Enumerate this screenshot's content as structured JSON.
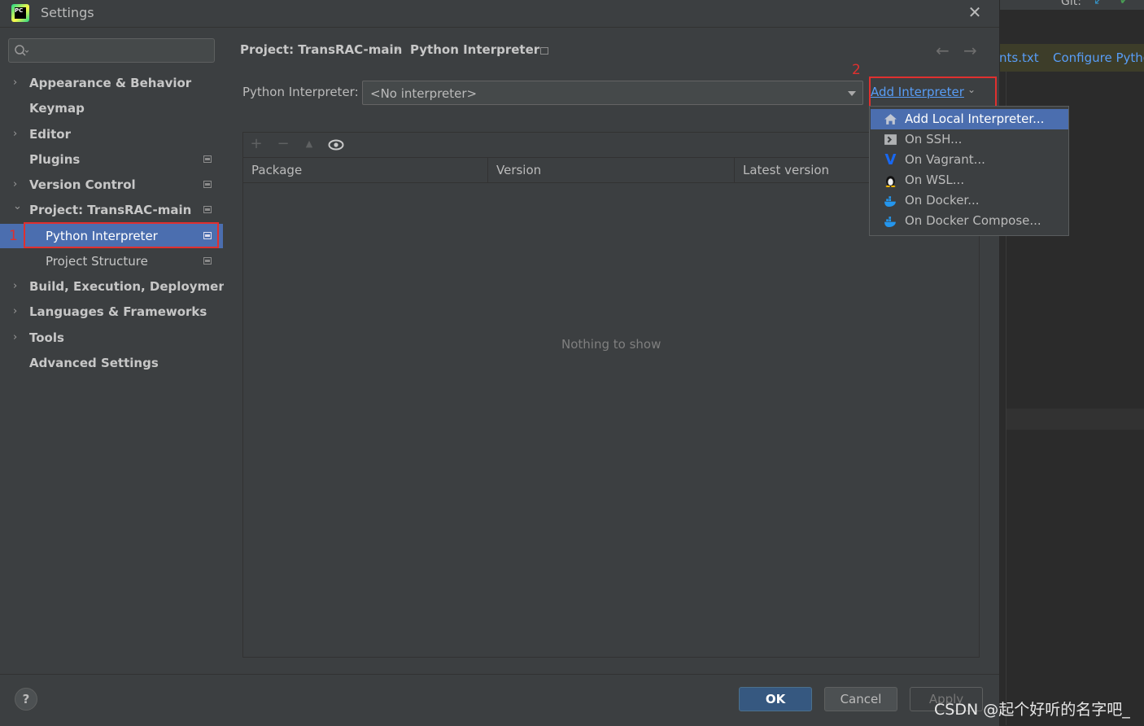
{
  "window": {
    "title": "Settings",
    "logo_text": "PC"
  },
  "sidebar": {
    "search_placeholder": "",
    "items": [
      {
        "label": "Appearance & Behavior",
        "expandable": true,
        "expanded": false,
        "project_icon": false
      },
      {
        "label": "Keymap",
        "expandable": false,
        "project_icon": false
      },
      {
        "label": "Editor",
        "expandable": true,
        "expanded": false,
        "project_icon": false
      },
      {
        "label": "Plugins",
        "expandable": false,
        "project_icon": true
      },
      {
        "label": "Version Control",
        "expandable": true,
        "expanded": false,
        "project_icon": true
      },
      {
        "label": "Project: TransRAC-main",
        "expandable": true,
        "expanded": true,
        "project_icon": true
      },
      {
        "label": "Python Interpreter",
        "child": true,
        "selected": true,
        "project_icon": true
      },
      {
        "label": "Project Structure",
        "child": true,
        "project_icon": true
      },
      {
        "label": "Build, Execution, Deployment",
        "expandable": true,
        "expanded": false,
        "project_icon": false
      },
      {
        "label": "Languages & Frameworks",
        "expandable": true,
        "expanded": false,
        "project_icon": false
      },
      {
        "label": "Tools",
        "expandable": true,
        "expanded": false,
        "project_icon": false
      },
      {
        "label": "Advanced Settings",
        "expandable": false,
        "project_icon": false
      }
    ]
  },
  "breadcrumb": {
    "project": "Project: TransRAC-main",
    "separator": "›",
    "page": "Python Interpreter"
  },
  "nav": {
    "back": "←",
    "forward": "→"
  },
  "interpreter": {
    "label": "Python Interpreter:",
    "value": "<No interpreter>",
    "add_link": "Add Interpreter"
  },
  "annotations": {
    "marker_1": "1",
    "marker_2": "2",
    "color": "#e0302f"
  },
  "packages": {
    "toolbar": {
      "add": "+",
      "remove": "−",
      "upgrade": "▲",
      "show_early": "👁"
    },
    "columns": [
      "Package",
      "Version",
      "Latest version"
    ],
    "empty_text": "Nothing to show"
  },
  "add_menu": {
    "items": [
      {
        "label": "Add Local Interpreter...",
        "icon": "house-icon",
        "highlighted": true
      },
      {
        "label": "On SSH...",
        "icon": "terminal-icon"
      },
      {
        "label": "On Vagrant...",
        "icon": "vagrant-icon"
      },
      {
        "label": "On WSL...",
        "icon": "linux-penguin-icon"
      },
      {
        "label": "On Docker...",
        "icon": "docker-icon"
      },
      {
        "label": "On Docker Compose...",
        "icon": "docker-compose-icon"
      }
    ]
  },
  "buttons": {
    "help": "?",
    "ok": "OK",
    "cancel": "Cancel",
    "apply": "Apply"
  },
  "background_ide": {
    "notification_file": "nts.txt",
    "notification_action": "Configure Pytho",
    "toolbar_text": "Git:"
  },
  "watermark": "CSDN @起个好听的名字吧_",
  "colors": {
    "selection": "#4b6eaf",
    "link": "#589df6",
    "ok_button": "#365880",
    "annotation": "#e0302f"
  }
}
